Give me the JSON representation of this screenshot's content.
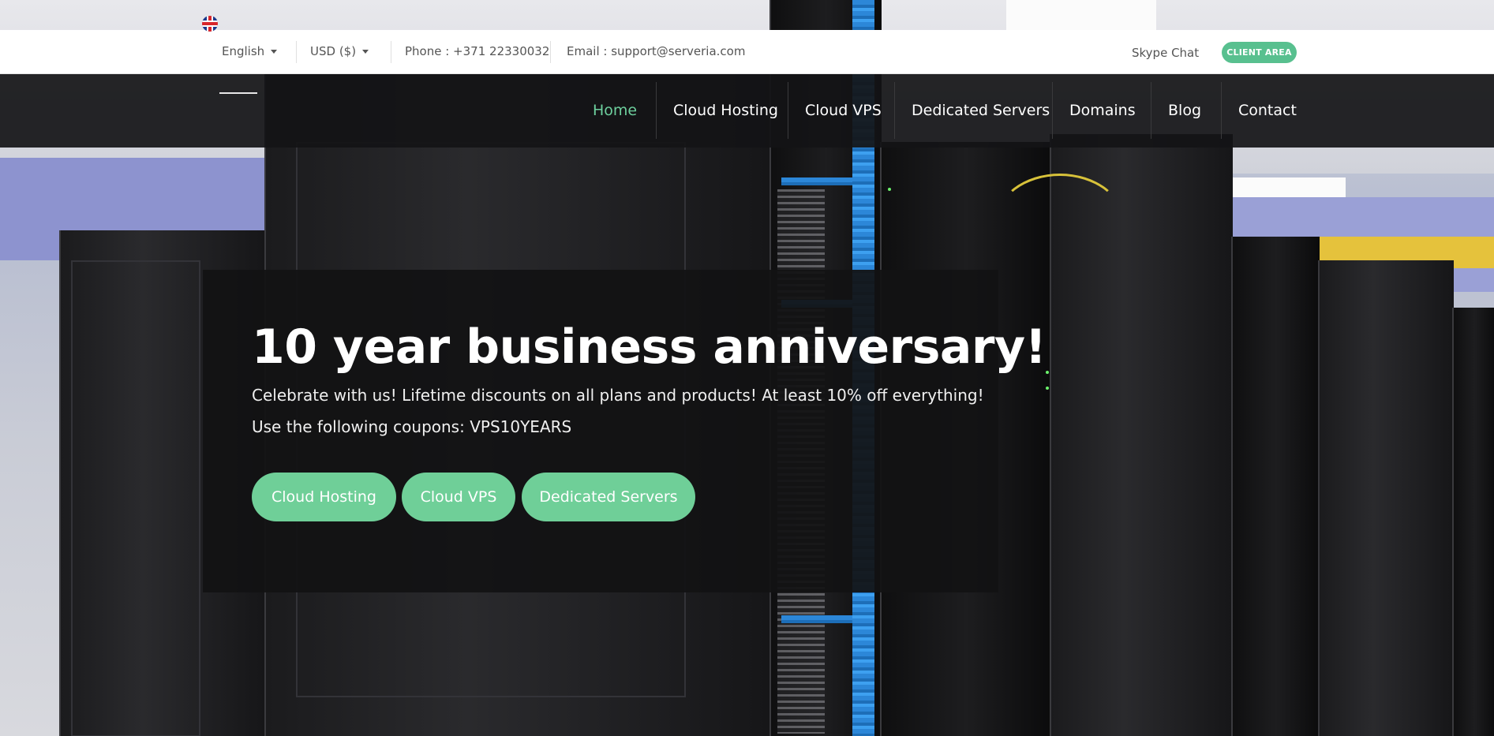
{
  "topbar": {
    "language": "English",
    "currency": "USD ($)",
    "phone": "Phone : +371 22330032",
    "email": "Email : support@serveria.com",
    "skype": "Skype Chat",
    "client_area": "CLIENT AREA",
    "icons": {
      "language_flag": "uk-flag-icon",
      "caret": "chevron-down-icon"
    }
  },
  "nav": {
    "items": [
      {
        "label": "Home",
        "active": true
      },
      {
        "label": "Cloud Hosting",
        "active": false
      },
      {
        "label": "Cloud VPS",
        "active": false
      },
      {
        "label": "Dedicated Servers",
        "active": false
      },
      {
        "label": "Domains",
        "active": false
      },
      {
        "label": "Blog",
        "active": false
      },
      {
        "label": "Contact",
        "active": false
      }
    ]
  },
  "hero": {
    "title": "10 year business anniversary!",
    "line1": "Celebrate with us! Lifetime discounts on all plans and products! At least 10% off everything!",
    "line2": "Use the following coupons: VPS10YEARS",
    "buttons": [
      "Cloud Hosting",
      "Cloud VPS",
      "Dedicated Servers"
    ]
  },
  "colors": {
    "accent": "#58c08f",
    "nav_active": "#6dcf9d",
    "cta": "#6fcf98",
    "nav_bg": "#141416"
  }
}
